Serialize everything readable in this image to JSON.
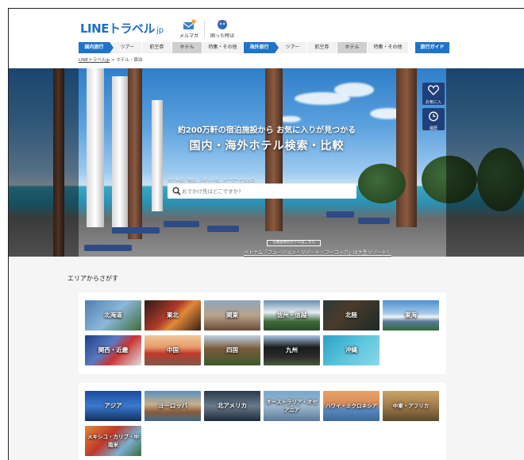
{
  "header": {
    "logo_main": "LINEトラベル",
    "logo_suffix": "jp",
    "mail_label": "メルマガ",
    "help_label": "困った時は"
  },
  "nav": {
    "domestic": {
      "label": "国内旅行",
      "items": [
        "ツアー",
        "航空券",
        "ホテル",
        "特集・その他"
      ]
    },
    "overseas": {
      "label": "海外旅行",
      "items": [
        "ツアー",
        "航空券",
        "ホテル",
        "特集・その他"
      ]
    },
    "guide": "旅行ガイド"
  },
  "breadcrumb": {
    "home": "LINEトラベルjp",
    "separator": " > ",
    "current": "ホテル・宿泊"
  },
  "hero": {
    "subtitle": "約200万軒の宿泊施設から お気に入りが見つかる",
    "title": "国内・海外ホテル検索・比較",
    "hint": "ホテル名、地名、スポット名、キーワードを入力",
    "search_placeholder": "おでかけ先はどこですか?",
    "favorites_label": "お気に入",
    "history_label": "履歴",
    "caption_box": "写真提供のホテルはこちら",
    "caption": "ベトナム「フュージョン・リゾート・フーコック」は大型リゾート！"
  },
  "area": {
    "title": "エリアからさがす",
    "domestic": [
      "北海道",
      "東北",
      "関東",
      "信州・信越",
      "北陸",
      "東海",
      "関西・近畿",
      "中国",
      "四国",
      "九州",
      "沖縄"
    ],
    "overseas": [
      "アジア",
      "ヨーロッパ",
      "北アメリカ",
      "オーストラリア・オセアニア",
      "ハワイ・ミクロネシア",
      "中東・アフリカ",
      "メキシコ・カリブ・中南米"
    ]
  },
  "colors": {
    "brand": "#1f73c9",
    "nav_active": "#cfcfcf"
  }
}
